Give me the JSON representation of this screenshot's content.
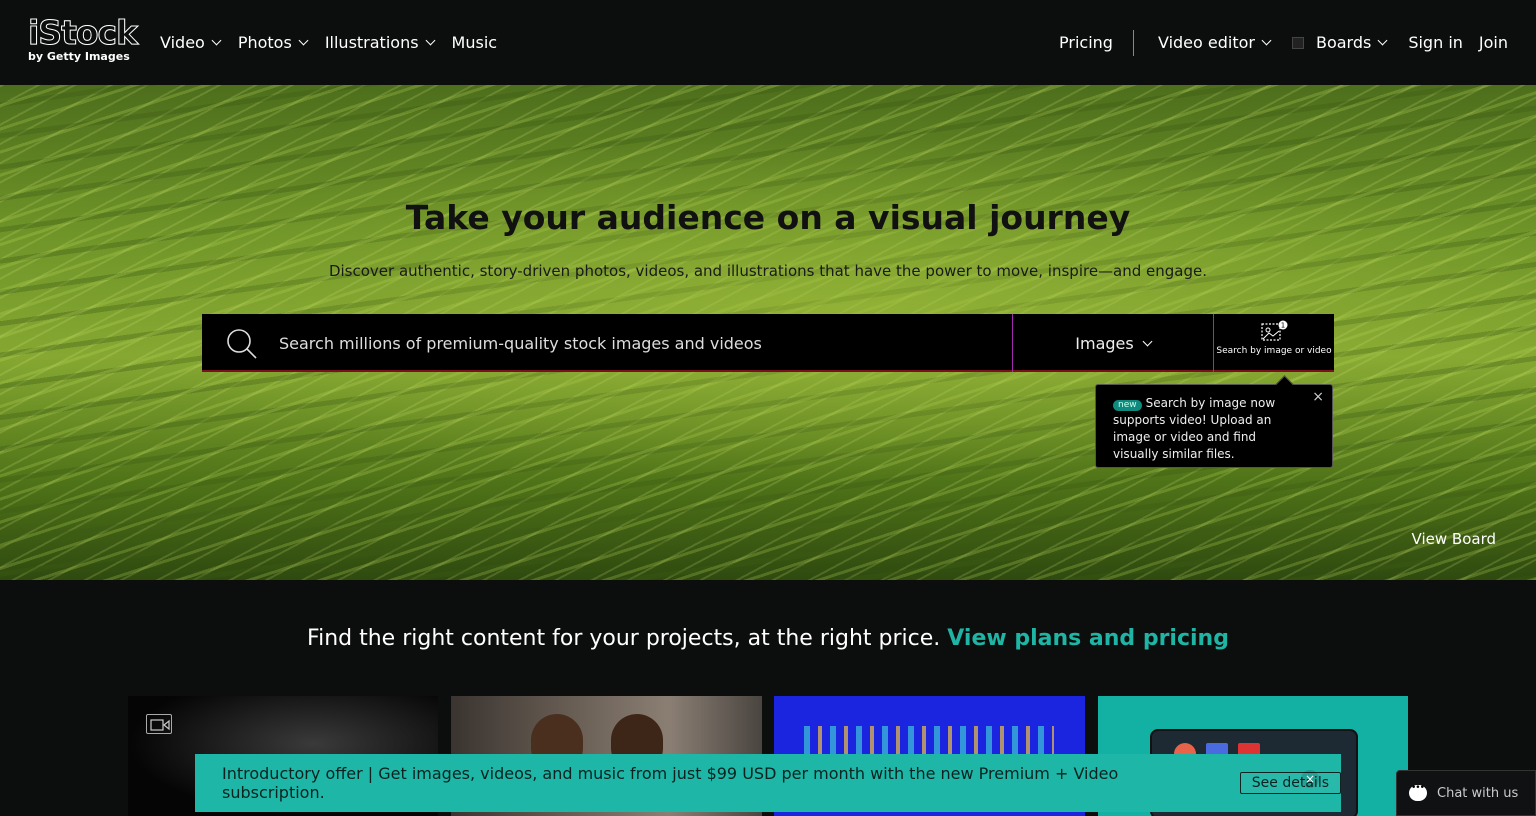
{
  "header": {
    "logo_text": "iStock",
    "logo_sub": "by Getty Images",
    "nav": [
      {
        "label": "Video",
        "dropdown": true
      },
      {
        "label": "Photos",
        "dropdown": true
      },
      {
        "label": "Illustrations",
        "dropdown": true
      },
      {
        "label": "Music",
        "dropdown": false
      }
    ],
    "pricing": "Pricing",
    "video_editor": "Video editor",
    "boards": "Boards",
    "sign_in": "Sign in",
    "join": "Join"
  },
  "hero": {
    "title": "Take your audience on a visual journey",
    "subtitle": "Discover authentic, story-driven photos, videos, and illustrations that have the power to move, inspire—and engage.",
    "search": {
      "placeholder": "Search millions of premium-quality stock images and videos",
      "type_selected": "Images",
      "by_image_label": "Search by image or video"
    },
    "tooltip": {
      "badge": "new",
      "text": "Search by image now supports video! Upload an image or video and find visually similar files.",
      "close": "×"
    },
    "view_board": "View Board"
  },
  "promo": {
    "text": "Find the right content for your projects, at the right price.",
    "link": "View plans and pricing"
  },
  "offer_banner": {
    "text": "Introductory offer | Get images, videos, and music from just $99 USD per month with the new Premium + Video subscription.",
    "button": "See details",
    "close": "×"
  },
  "chat": {
    "label": "Chat with us"
  },
  "colors": {
    "accent": "#1fb5a4",
    "header_bg": "#0c0d0d",
    "search_divider": "#a02bb0"
  }
}
